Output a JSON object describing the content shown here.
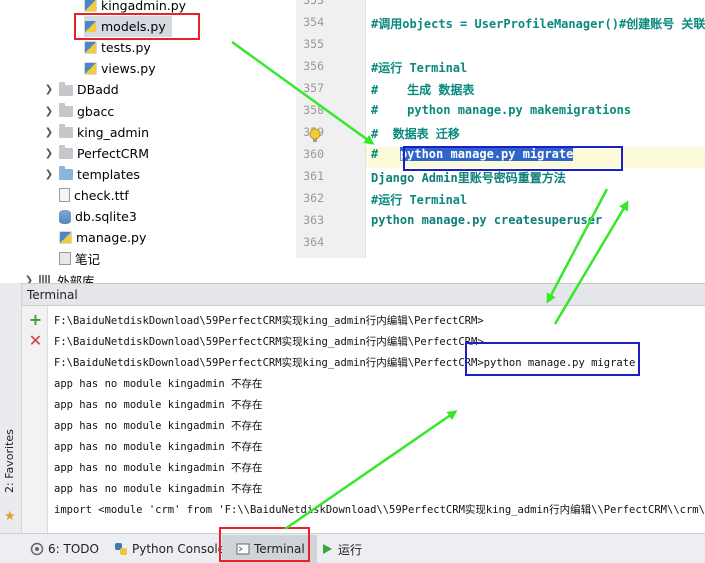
{
  "project_tree": {
    "items": [
      {
        "label": "kingadmin.py",
        "icon": "python-file-icon",
        "indent": 2,
        "expandable": false
      },
      {
        "label": "models.py",
        "icon": "python-file-icon",
        "indent": 2,
        "expandable": false
      },
      {
        "label": "tests.py",
        "icon": "python-file-icon",
        "indent": 2,
        "expandable": false
      },
      {
        "label": "views.py",
        "icon": "python-file-icon",
        "indent": 2,
        "expandable": false
      },
      {
        "label": "DBadd",
        "icon": "folder-icon",
        "indent": 1,
        "expandable": true
      },
      {
        "label": "gbacc",
        "icon": "folder-icon",
        "indent": 1,
        "expandable": true
      },
      {
        "label": "king_admin",
        "icon": "folder-icon",
        "indent": 1,
        "expandable": true
      },
      {
        "label": "PerfectCRM",
        "icon": "folder-icon",
        "indent": 1,
        "expandable": true
      },
      {
        "label": "templates",
        "icon": "folder-icon-blue",
        "indent": 1,
        "expandable": true
      },
      {
        "label": "check.ttf",
        "icon": "file-icon",
        "indent": 1,
        "expandable": false
      },
      {
        "label": "db.sqlite3",
        "icon": "database-icon",
        "indent": 1,
        "expandable": false
      },
      {
        "label": "manage.py",
        "icon": "python-file-icon",
        "indent": 1,
        "expandable": false
      },
      {
        "label": "笔记",
        "icon": "notes-file-icon",
        "indent": 1,
        "expandable": false
      },
      {
        "label": "外部库",
        "icon": "library-icon",
        "indent": 0,
        "expandable": true
      }
    ]
  },
  "editor": {
    "line_numbers": [
      "353",
      "354",
      "355",
      "356",
      "357",
      "358",
      "359",
      "360",
      "361",
      "362",
      "363",
      "364"
    ],
    "lines": [
      {
        "text": ""
      },
      {
        "text": "#调用objects = UserProfileManager()#创建账号 关联这个函数"
      },
      {
        "text": ""
      },
      {
        "text": "#运行 Terminal"
      },
      {
        "text": "#    生成 数据表"
      },
      {
        "text": "#    python manage.py makemigrations"
      },
      {
        "text": "#  数据表 迁移"
      },
      {
        "text": "#    python manage.py migrate"
      },
      {
        "text": "Django Admin里账号密码重置方法"
      },
      {
        "text": "#运行 Terminal"
      },
      {
        "text": "python manage.py createsuperuser"
      },
      {
        "text": ""
      }
    ],
    "line360_prefix": "#   ",
    "line360_selected": "python manage.py migrate"
  },
  "terminal": {
    "title": "Terminal",
    "add_tooltip": "New session",
    "close_tooltip": "Close session",
    "lines": [
      "F:\\BaiduNetdiskDownload\\59PerfectCRM实现king_admin行内编辑\\PerfectCRM>",
      "F:\\BaiduNetdiskDownload\\59PerfectCRM实现king_admin行内编辑\\PerfectCRM>",
      "F:\\BaiduNetdiskDownload\\59PerfectCRM实现king_admin行内编辑\\PerfectCRM>python manage.py migrate",
      "app has no module kingadmin 不存在",
      "app has no module kingadmin 不存在",
      "app has no module kingadmin 不存在",
      "app has no module kingadmin 不存在",
      "app has no module kingadmin 不存在",
      "app has no module kingadmin 不存在",
      "import  <module 'crm' from 'F:\\\\BaiduNetdiskDownload\\\\59PerfectCRM实现king_admin行内编辑\\\\PerfectCRM\\\\crm\\\\__init__.py'>"
    ]
  },
  "left_strip": {
    "favorites_label": "2: Favorites"
  },
  "bottom_bar": {
    "todo_label": "6: TODO",
    "python_console_label": "Python Console",
    "terminal_label": "Terminal",
    "run_label": "运行"
  },
  "colors": {
    "annotation_red": "#e8222a",
    "annotation_blue": "#1a1fc8",
    "annotation_green": "#35e82a",
    "selection_blue": "#2f65ca"
  }
}
